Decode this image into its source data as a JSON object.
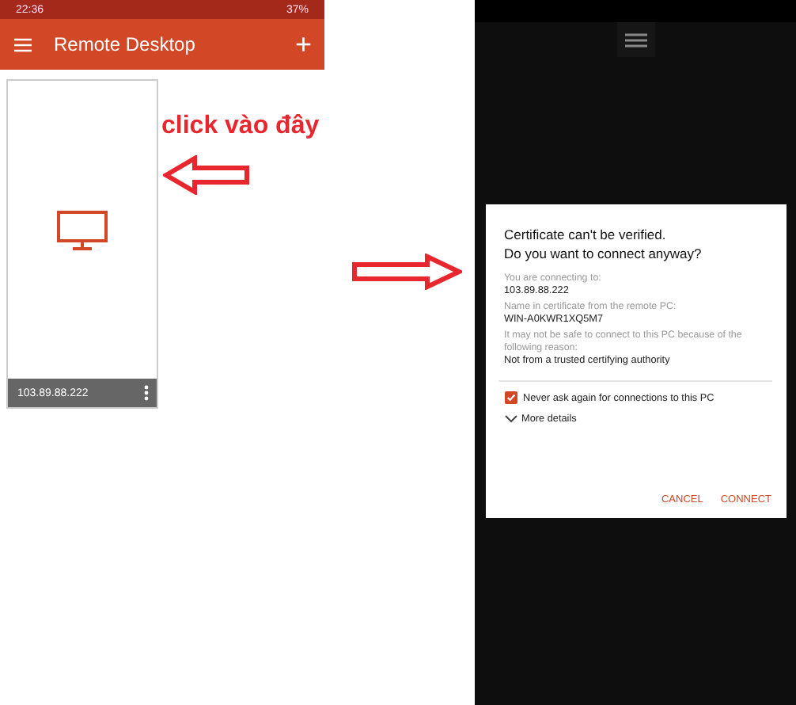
{
  "left_phone": {
    "status_bar": {
      "time": "22:36",
      "battery": "37%"
    },
    "app_bar": {
      "title": "Remote Desktop",
      "add": "+"
    },
    "tiles": [
      {
        "label": "103.89.88.222"
      }
    ]
  },
  "annotation": {
    "text": "click vào đây"
  },
  "right_phone": {
    "dialog": {
      "title": "Certificate can't be verified.\nDo you want to connect anyway?",
      "fields": [
        {
          "label": "You are connecting to:",
          "value": "103.89.88.222"
        },
        {
          "label": "Name in certificate from the remote PC:",
          "value": "WIN-A0KWR1XQ5M7"
        },
        {
          "label": "It may not be safe to connect to this PC because of the following reason:",
          "value": "Not from a trusted certifying authority"
        }
      ],
      "checkbox": {
        "label": "Never ask again for connections to this PC",
        "checked": true
      },
      "details": {
        "label": "More details",
        "expanded": false
      },
      "buttons": [
        "CANCEL",
        "CONNECT"
      ]
    }
  }
}
